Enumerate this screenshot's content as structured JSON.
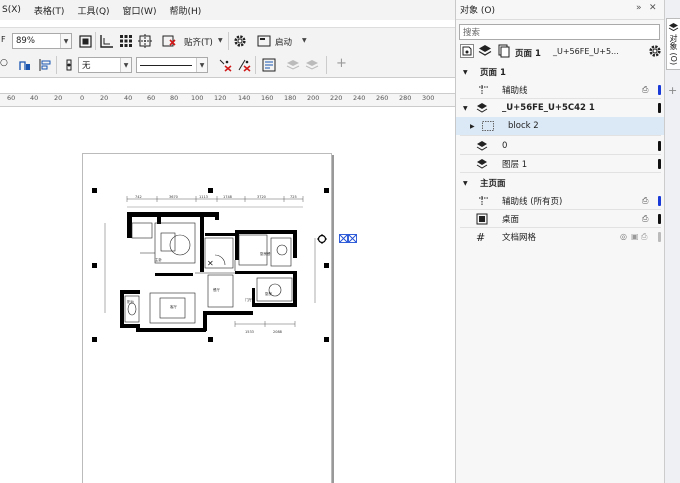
{
  "menubar": {
    "items": [
      "S(X)",
      "表格(T)",
      "工具(Q)",
      "窗口(W)",
      "帮助(H)"
    ]
  },
  "toolbar1": {
    "left_label": "F",
    "zoom_value": "89%",
    "snap_label": "贴齐(T)",
    "launch_label": "启动"
  },
  "toolbar2": {
    "fill_value": "无"
  },
  "ruler": {
    "ticks": [
      "60",
      "40",
      "20",
      "0",
      "20",
      "40",
      "60",
      "80",
      "100",
      "120",
      "140",
      "160",
      "180",
      "200",
      "220",
      "240",
      "260",
      "280",
      "300"
    ]
  },
  "docker": {
    "title": "对象 (O)",
    "search_placeholder": "搜索",
    "page_label": "页面 1",
    "layer_label": "_U+56FE_U+5...",
    "tree": [
      {
        "text": "页面 1",
        "kind": "header"
      },
      {
        "text": "辅助线",
        "kind": "item"
      },
      {
        "text": "_U+56FE_U+5C42 1",
        "kind": "layer-header"
      },
      {
        "text": "block 2",
        "kind": "selected"
      },
      {
        "text": "0",
        "kind": "item"
      },
      {
        "text": "图层 1",
        "kind": "item"
      },
      {
        "text": "主页面",
        "kind": "header"
      },
      {
        "text": "辅助线 (所有页)",
        "kind": "item"
      },
      {
        "text": "桌面",
        "kind": "item"
      },
      {
        "text": "文档网格",
        "kind": "item"
      }
    ]
  },
  "tabstrip": {
    "tab_label": "对象 (O)"
  },
  "colors": {
    "guide_blue": "#1a3ad8",
    "layer_black": "#111111",
    "selection_blue": "#dbe8f5"
  }
}
